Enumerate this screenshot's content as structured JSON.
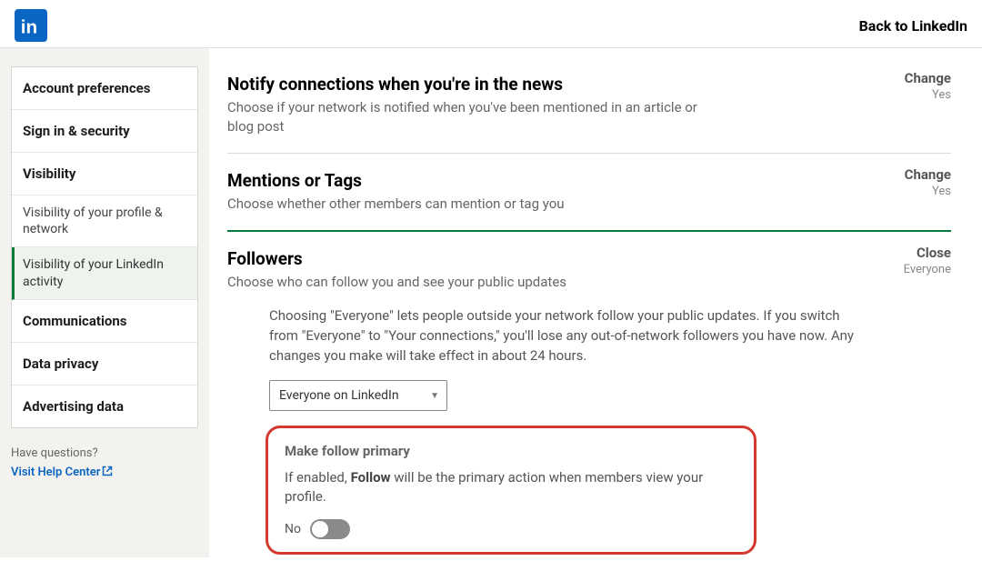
{
  "header": {
    "back_label": "Back to LinkedIn"
  },
  "sidebar": {
    "items": [
      {
        "label": "Account preferences"
      },
      {
        "label": "Sign in & security"
      },
      {
        "label": "Visibility"
      },
      {
        "label": "Visibility of your profile & network"
      },
      {
        "label": "Visibility of your LinkedIn activity"
      },
      {
        "label": "Communications"
      },
      {
        "label": "Data privacy"
      },
      {
        "label": "Advertising data"
      }
    ],
    "help_question": "Have questions?",
    "help_link": "Visit Help Center"
  },
  "sections": {
    "news": {
      "title": "Notify connections when you're in the news",
      "subtitle": "Choose if your network is notified when you've been mentioned in an article or blog post",
      "action": "Change",
      "value": "Yes"
    },
    "mentions": {
      "title": "Mentions or Tags",
      "subtitle": "Choose whether other members can mention or tag you",
      "action": "Change",
      "value": "Yes"
    },
    "followers": {
      "title": "Followers",
      "subtitle": "Choose who can follow you and see your public updates",
      "action": "Close",
      "value": "Everyone",
      "body": "Choosing \"Everyone\" lets people outside your network follow your public updates. If you switch from \"Everyone\" to \"Your connections,\" you'll lose any out-of-network followers you have now. Any changes you make will take effect in about 24 hours.",
      "select_value": "Everyone on LinkedIn",
      "primary": {
        "heading": "Make follow primary",
        "desc_pre": "If enabled, ",
        "desc_bold": "Follow",
        "desc_post": " will be the primary action when members view your profile.",
        "toggle_label": "No"
      }
    }
  }
}
